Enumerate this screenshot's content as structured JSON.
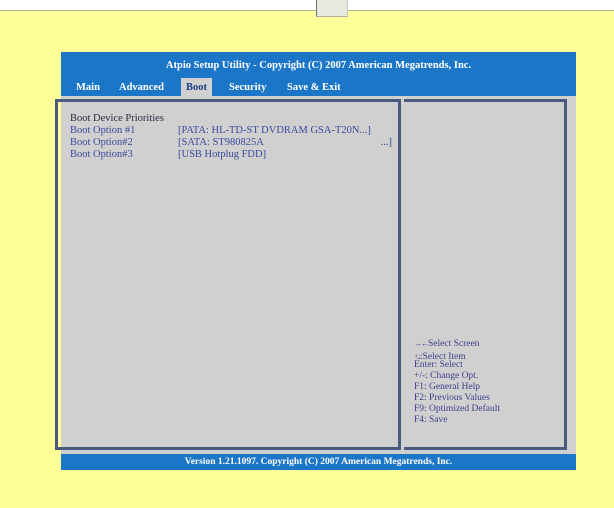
{
  "bios": {
    "title": "Atpio Setup Utility - Copyright (C) 2007 American Megatrends, Inc.",
    "menu": [
      "Main",
      "Advanced",
      "Boot",
      "Security",
      "Save & Exit"
    ],
    "active_menu": "Boot",
    "section_title": "Boot Device Priorities",
    "options": [
      {
        "label": "Boot Option #1",
        "value": "[PATA: HL-TD-ST DVDRAM GSA-T20N...]",
        "suffix": ""
      },
      {
        "label": "Boot Option#2",
        "value": "[SATA: ST980825A",
        "suffix": "...]"
      },
      {
        "label": "Boot Option#3",
        "value": "[USB Hotplug FDD]",
        "suffix": ""
      }
    ],
    "help": [
      {
        "icon": "left-right-arrows-icon",
        "glyph": "→←",
        "text": "Select Screen"
      },
      {
        "icon": "up-down-arrows-icon",
        "glyph": "↑↓",
        "text": ":Select Item"
      },
      {
        "icon": "",
        "glyph": "",
        "text": "Enter: Select"
      },
      {
        "icon": "",
        "glyph": "",
        "text": "+/-: Change Opt."
      },
      {
        "icon": "",
        "glyph": "",
        "text": "F1: General Help"
      },
      {
        "icon": "",
        "glyph": "",
        "text": "F2: Previous Values"
      },
      {
        "icon": "",
        "glyph": "",
        "text": "F9: Optimized Default"
      },
      {
        "icon": "",
        "glyph": "",
        "text": "F4: Save"
      }
    ],
    "footer": "Version  1.21.1097. Copyright (C) 2007 American Megatrends, Inc.",
    "colors": {
      "blue": "#1c76c8",
      "panel": "#d0d0d0",
      "border": "#4a5a7e",
      "page_background": "#ffff99"
    }
  }
}
